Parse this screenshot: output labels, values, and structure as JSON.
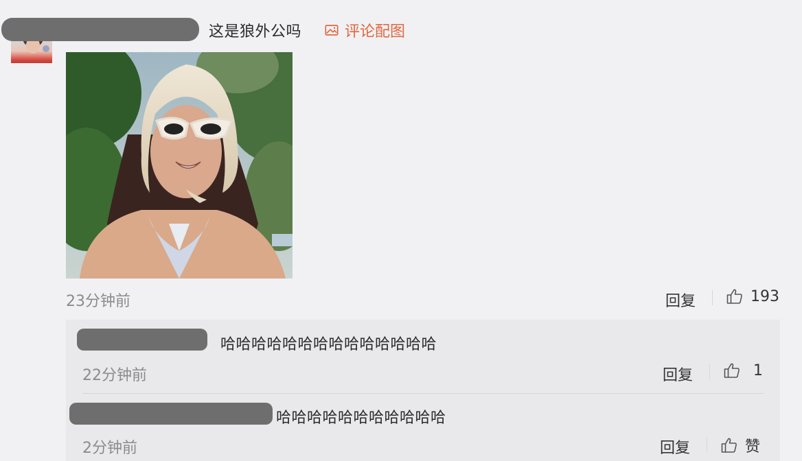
{
  "comment": {
    "text": "这是狼外公吗",
    "attach_label": "评论配图",
    "time": "23分钟前",
    "reply_label": "回复",
    "like_count": "193"
  },
  "replies": [
    {
      "text": "哈哈哈哈哈哈哈哈哈哈哈哈哈哈",
      "time": "22分钟前",
      "reply_label": "回复",
      "like_count": "1"
    },
    {
      "text": "哈哈哈哈哈哈哈哈哈哈哈",
      "time": "2分钟前",
      "reply_label": "回复",
      "like_label": "赞"
    }
  ],
  "colors": {
    "accent": "#e0683f",
    "background": "#f1f1f4",
    "reply_box": "#e9e9ec",
    "muted_text": "#8b8b8b"
  },
  "icons": {
    "attach": "image-icon",
    "like": "thumbs-up-icon"
  }
}
